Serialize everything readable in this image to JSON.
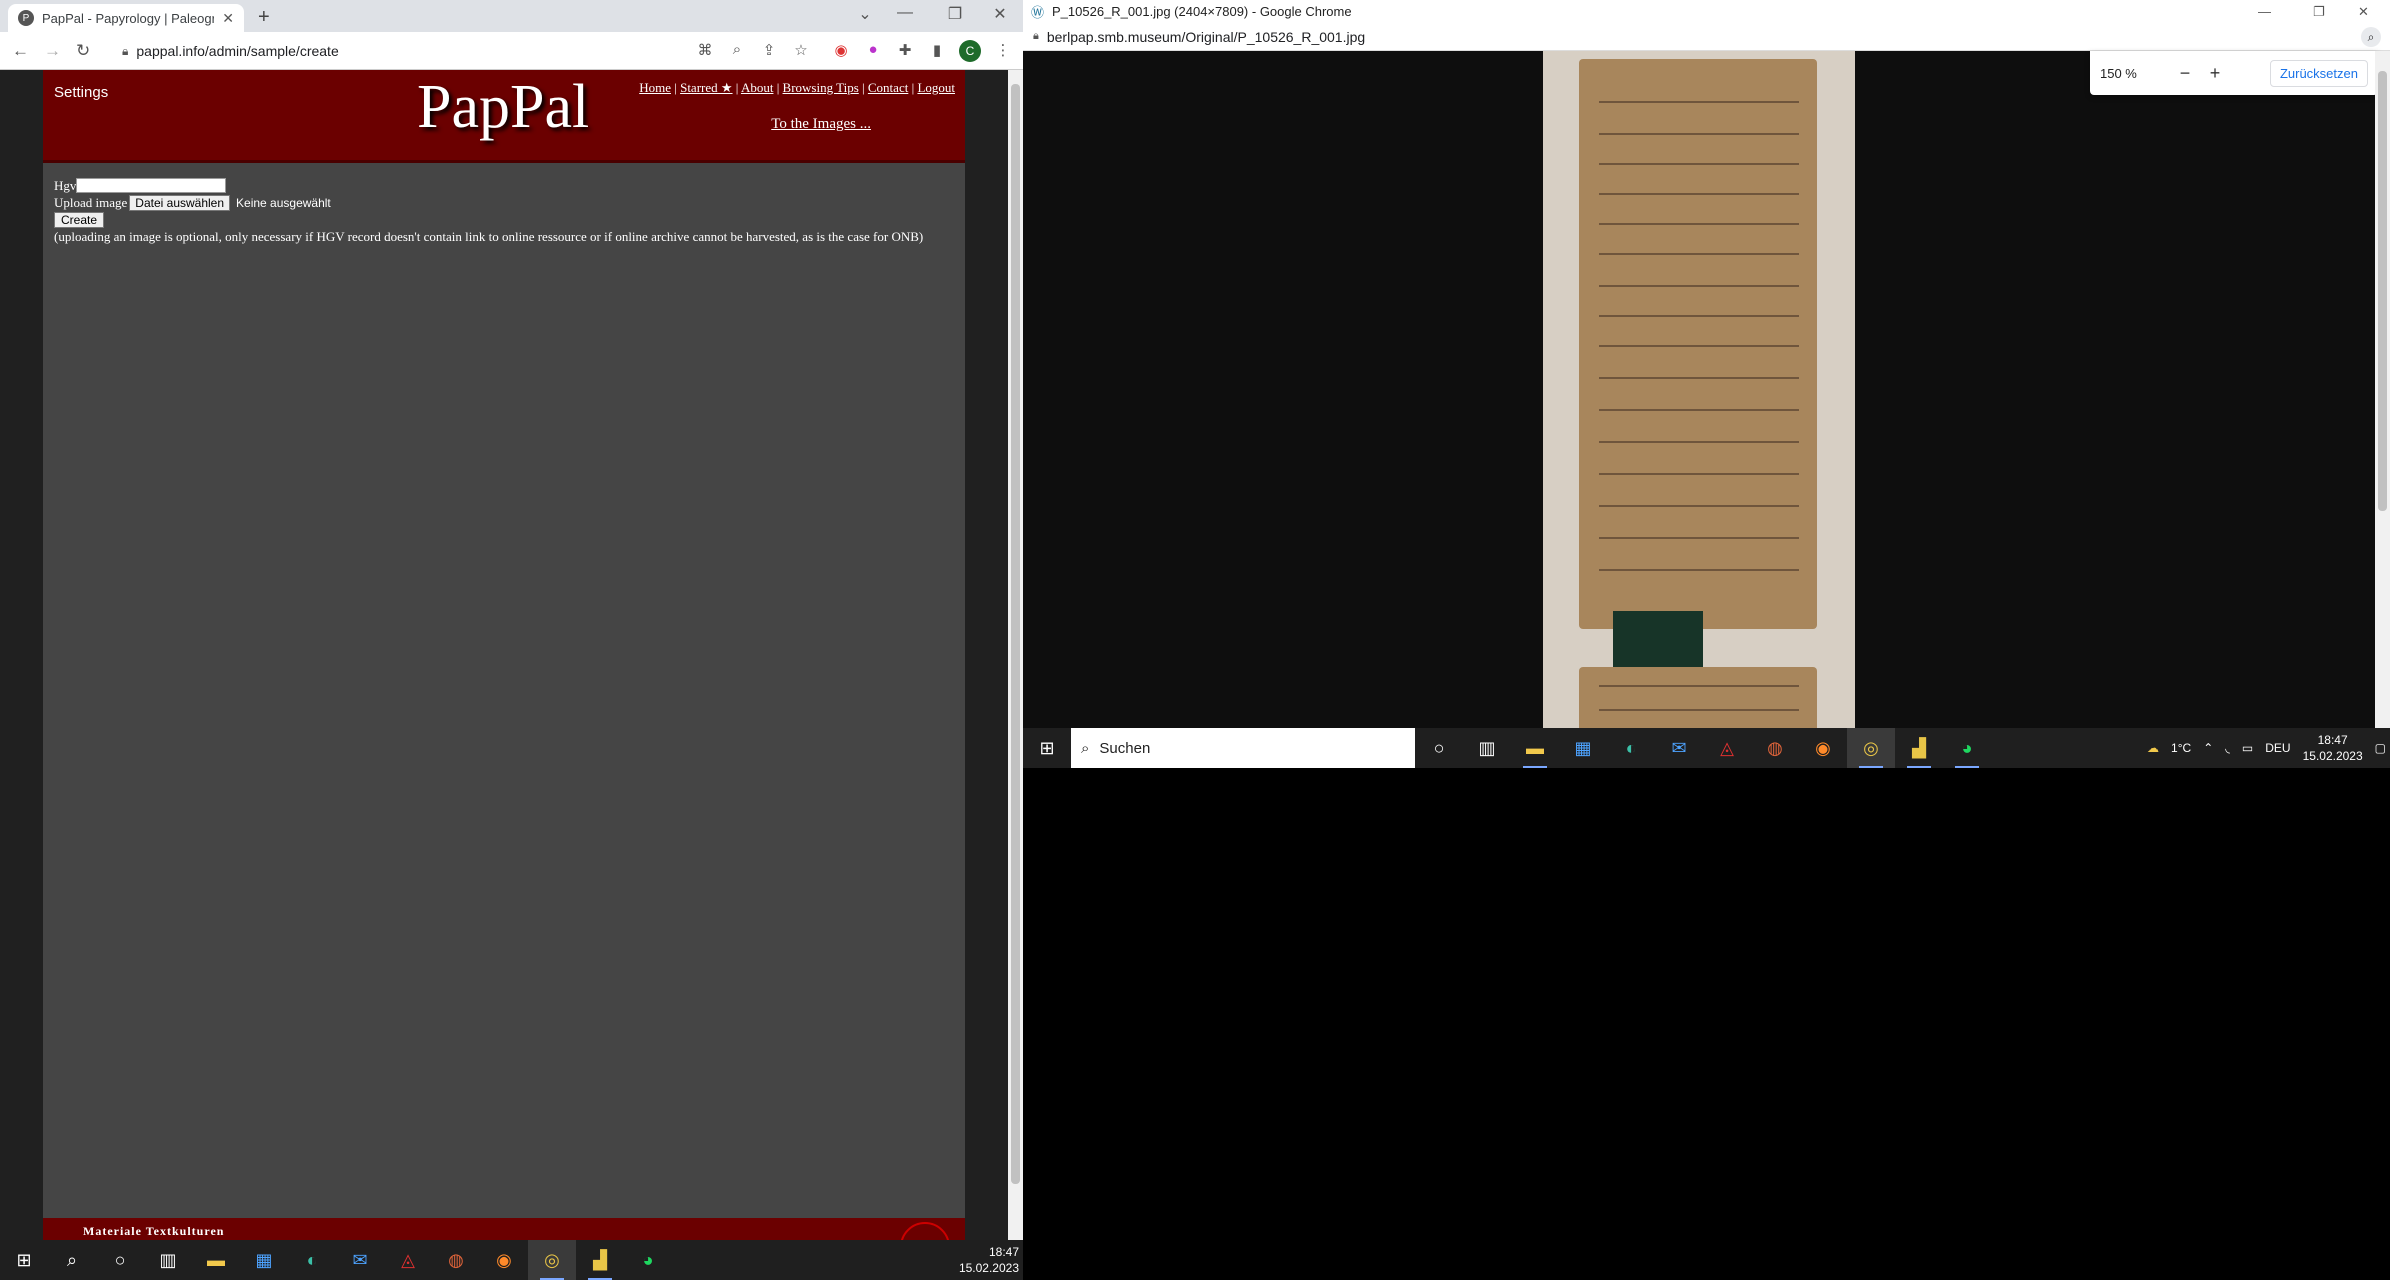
{
  "left_window": {
    "tab_title": "PapPal - Papyrology | Paleograph",
    "tab_favicon_letter": "P",
    "url": "pappal.info/admin/sample/create",
    "profile_initial": "C",
    "page": {
      "settings_label": "Settings",
      "logo": "PapPal",
      "nav": [
        "Home",
        "Starred ★",
        "About",
        "Browsing Tips",
        "Contact",
        "Logout"
      ],
      "to_images": "To the Images ...",
      "form": {
        "hgv_label": "Hgv",
        "hgv_value": "",
        "upload_label": "Upload image",
        "file_button": "Datei auswählen",
        "no_file": "Keine ausgewählt",
        "create_button": "Create",
        "note": "(uploading an image is optional, only necessary if HGV record doesn't contain link to online ressource or if online archive cannot be harvested, as is the case for ONB)"
      },
      "footer_text": "Materiale Textkulturen"
    },
    "taskbar": {
      "time": "18:47",
      "date": "15.02.2023",
      "icons": [
        "windows-icon",
        "search-icon",
        "cortana-icon",
        "task-view-icon",
        "file-explorer-icon",
        "store-icon",
        "edge-icon",
        "mail-icon",
        "acrobat-icon",
        "powerpoint-icon",
        "firefox-icon",
        "chrome-icon",
        "notes-icon",
        "spotify-icon"
      ]
    }
  },
  "right_window": {
    "title": "P_10526_R_001.jpg (2404×7809) - Google Chrome",
    "url": "berlpap.smb.museum/Original/P_10526_R_001.jpg",
    "zoom_percent": "150 %",
    "reset_label": "Zurücksetzen",
    "taskbar": {
      "search_placeholder": "Suchen",
      "temperature": "1°C",
      "language": "DEU",
      "time": "18:47",
      "date": "15.02.2023"
    }
  },
  "colors": {
    "banner_red": "#6b0000",
    "page_gray": "#454545",
    "papyrus_brown": "#a8865c"
  }
}
